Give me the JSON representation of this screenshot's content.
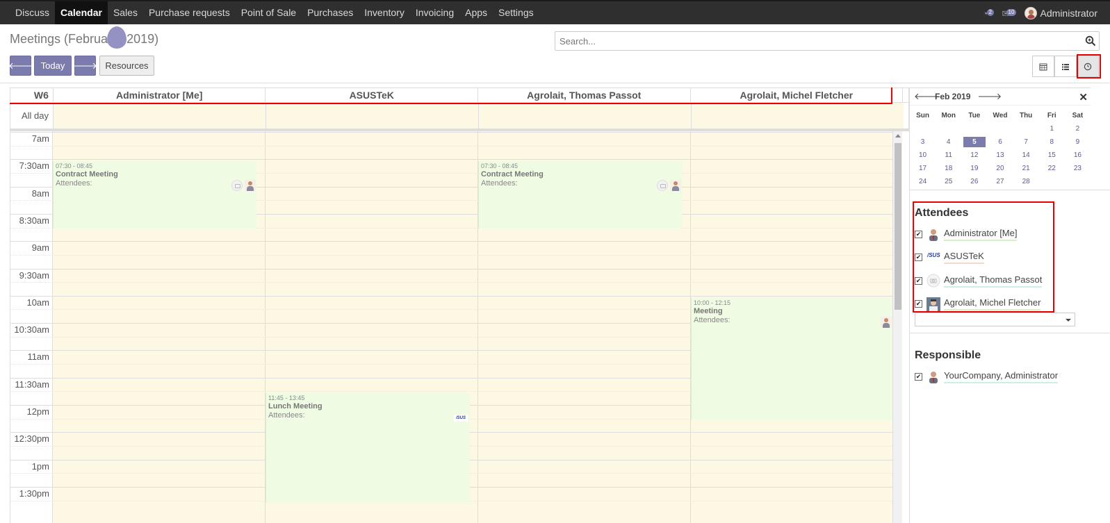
{
  "nav": {
    "items": [
      "Discuss",
      "Calendar",
      "Sales",
      "Purchase requests",
      "Point of Sale",
      "Purchases",
      "Inventory",
      "Invoicing",
      "Apps",
      "Settings"
    ],
    "active": "Calendar",
    "systray": {
      "activity_count": "2",
      "messages_count": "10",
      "user": "Administrator"
    }
  },
  "control": {
    "title": "Meetings (Februa",
    "title_tail": ", 2019)",
    "search_placeholder": "Search...",
    "today_label": "Today",
    "resources_label": "Resources",
    "views": [
      "calendar-view",
      "list-view",
      "timeline-view"
    ],
    "active_view": "timeline-view"
  },
  "calendar": {
    "week_label": "W6",
    "all_day_label": "All day",
    "resources": [
      "Administrator [Me]",
      "ASUSTeK",
      "Agrolait, Thomas Passot",
      "Agrolait, Michel Fletcher"
    ],
    "time_slots": [
      "7am",
      "7:30am",
      "8am",
      "8:30am",
      "9am",
      "9:30am",
      "10am",
      "10:30am",
      "11am",
      "11:30am",
      "12pm",
      "12:30pm",
      "1pm",
      "1:30pm"
    ],
    "events": [
      {
        "time": "07:30 - 08:45",
        "name": "Contract Meeting",
        "attendees_label": "Attendees:"
      },
      {
        "time": "07:30 - 08:45",
        "name": "Contract Meeting",
        "attendees_label": "Attendees:"
      },
      {
        "time": "10:00 - 12:15",
        "name": "Meeting",
        "attendees_label": "Attendees:"
      },
      {
        "time": "11:45 - 13:45",
        "name": "Lunch Meeting",
        "attendees_label": "Attendees:"
      }
    ],
    "asus_logo_text": "/SUS"
  },
  "sidebar": {
    "mini_calendar": {
      "month": "Feb 2019",
      "weekdays": [
        "Sun",
        "Mon",
        "Tue",
        "Wed",
        "Thu",
        "Fri",
        "Sat"
      ],
      "weeks": [
        [
          "",
          "",
          "",
          "",
          "",
          "1",
          "2"
        ],
        [
          "3",
          "4",
          "5",
          "6",
          "7",
          "8",
          "9"
        ],
        [
          "10",
          "11",
          "12",
          "13",
          "14",
          "15",
          "16"
        ],
        [
          "17",
          "18",
          "19",
          "20",
          "21",
          "22",
          "23"
        ],
        [
          "24",
          "25",
          "26",
          "27",
          "28",
          "",
          ""
        ]
      ],
      "selected_day": "5"
    },
    "attendees": {
      "title": "Attendees",
      "items": [
        {
          "name": "Administrator [Me]",
          "checked": true,
          "color": "#d8f0c8"
        },
        {
          "name": "ASUSTeK",
          "checked": true,
          "color": "#f6d8c8"
        },
        {
          "name": "Agrolait, Thomas Passot",
          "checked": true,
          "color": "#c8f0e8"
        },
        {
          "name": "Agrolait, Michel Fletcher",
          "checked": true,
          "color": "#d8f0c8"
        }
      ]
    },
    "responsible": {
      "title": "Responsible",
      "items": [
        {
          "name": "YourCompany, Administrator",
          "checked": true,
          "color": "#c8f0e8"
        }
      ]
    }
  },
  "colors": {
    "primary": "#7c7bad",
    "navbar": "#2f2f2f",
    "cell": "#fcf8e3",
    "event": "#f0fbe4",
    "highlight": "#ee0000"
  }
}
